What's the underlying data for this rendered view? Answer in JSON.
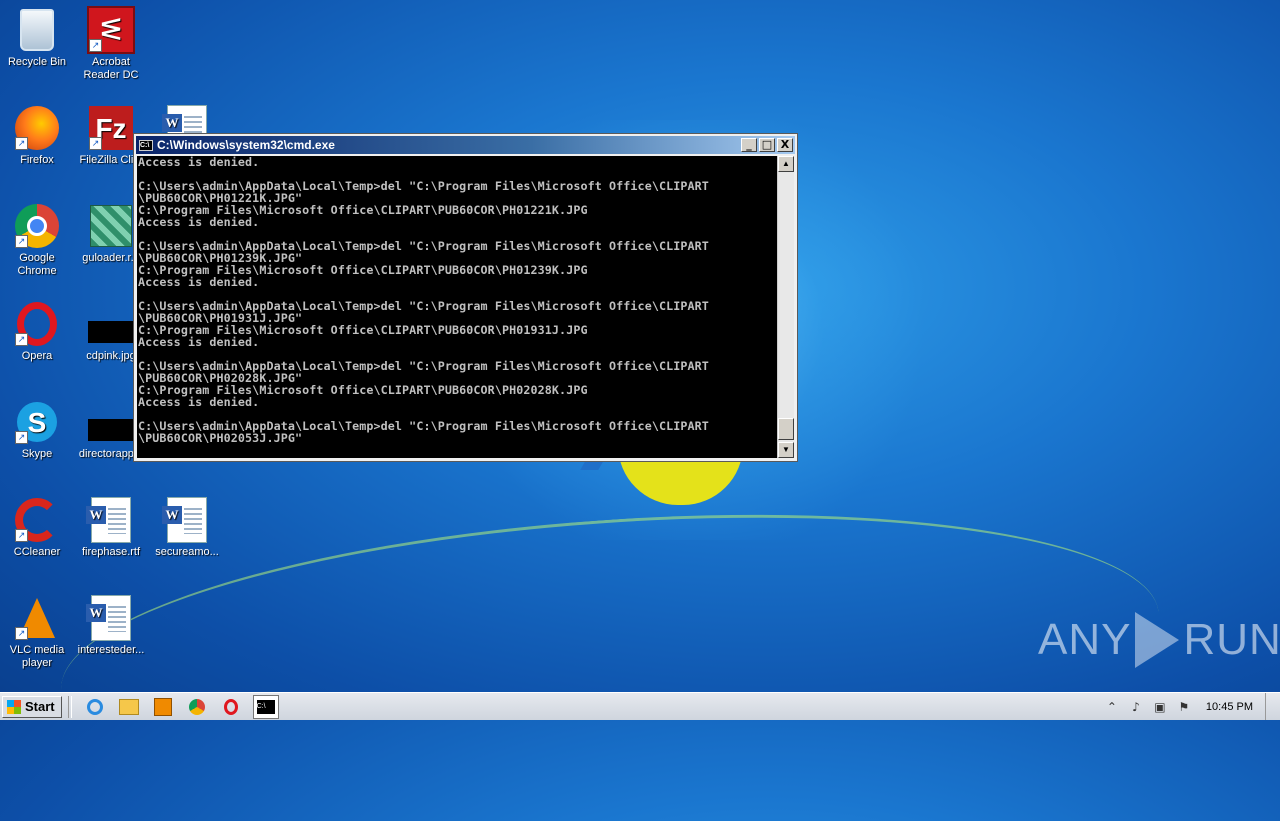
{
  "desktop": {
    "icons": [
      {
        "label": "Recycle Bin",
        "icon": "recycle-bin-icon"
      },
      {
        "label": "Acrobat Reader DC",
        "icon": "acrobat-reader-icon"
      },
      {
        "label": "Firefox",
        "icon": "firefox-icon"
      },
      {
        "label": "FileZilla Cli...",
        "icon": "filezilla-icon"
      },
      {
        "label": "Google Chrome",
        "icon": "chrome-icon"
      },
      {
        "label": "guloader.r...",
        "icon": "guloader-icon"
      },
      {
        "label": "Opera",
        "icon": "opera-icon"
      },
      {
        "label": "cdpink.jpg",
        "icon": "image-file-icon"
      },
      {
        "label": "Skype",
        "icon": "skype-icon"
      },
      {
        "label": "directorapp...",
        "icon": "image-file-icon"
      },
      {
        "label": "CCleaner",
        "icon": "ccleaner-icon"
      },
      {
        "label": "firephase.rtf",
        "icon": "word-doc-icon"
      },
      {
        "label": "secureamo...",
        "icon": "word-doc-icon"
      },
      {
        "label": "VLC media player",
        "icon": "vlc-icon"
      },
      {
        "label": "interesteder...",
        "icon": "word-doc-icon"
      }
    ]
  },
  "cmd_window": {
    "title": "C:\\Windows\\system32\\cmd.exe",
    "icon": "cmd-icon",
    "buttons": {
      "minimize": "_",
      "maximize": "□",
      "close": "X"
    },
    "output": "Access is denied.\n\nC:\\Users\\admin\\AppData\\Local\\Temp>del \"C:\\Program Files\\Microsoft Office\\CLIPART\n\\PUB60COR\\PH01221K.JPG\"\nC:\\Program Files\\Microsoft Office\\CLIPART\\PUB60COR\\PH01221K.JPG\nAccess is denied.\n\nC:\\Users\\admin\\AppData\\Local\\Temp>del \"C:\\Program Files\\Microsoft Office\\CLIPART\n\\PUB60COR\\PH01239K.JPG\"\nC:\\Program Files\\Microsoft Office\\CLIPART\\PUB60COR\\PH01239K.JPG\nAccess is denied.\n\nC:\\Users\\admin\\AppData\\Local\\Temp>del \"C:\\Program Files\\Microsoft Office\\CLIPART\n\\PUB60COR\\PH01931J.JPG\"\nC:\\Program Files\\Microsoft Office\\CLIPART\\PUB60COR\\PH01931J.JPG\nAccess is denied.\n\nC:\\Users\\admin\\AppData\\Local\\Temp>del \"C:\\Program Files\\Microsoft Office\\CLIPART\n\\PUB60COR\\PH02028K.JPG\"\nC:\\Program Files\\Microsoft Office\\CLIPART\\PUB60COR\\PH02028K.JPG\nAccess is denied.\n\nC:\\Users\\admin\\AppData\\Local\\Temp>del \"C:\\Program Files\\Microsoft Office\\CLIPART\n\\PUB60COR\\PH02053J.JPG\""
  },
  "watermark": {
    "left": "ANY",
    "right": "RUN"
  },
  "taskbar": {
    "start_label": "Start",
    "pinned": [
      "internet-explorer-icon",
      "folder-icon",
      "media-player-icon",
      "chrome-icon",
      "opera-icon",
      "cmd-icon"
    ],
    "tray_icons": [
      "chevron-up-icon",
      "speaker-icon",
      "network-icon",
      "flag-icon"
    ],
    "clock": "10:45 PM"
  }
}
